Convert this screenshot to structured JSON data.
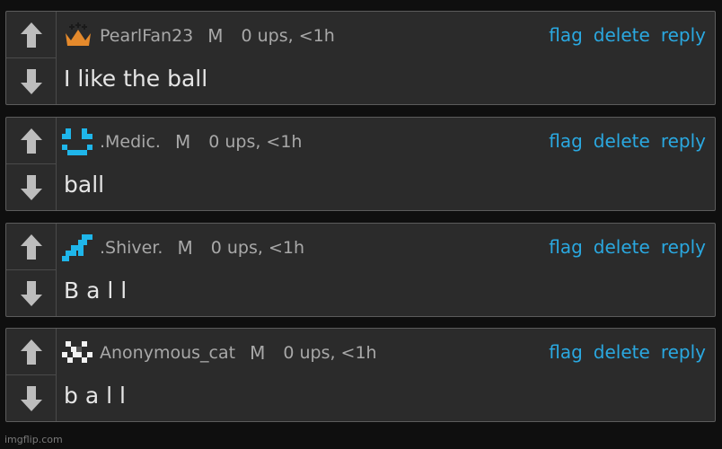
{
  "comments": [
    {
      "username": "PearlFan23",
      "mod_badge": "M",
      "meta": "0 ups, <1h",
      "text": "I like the ball",
      "avatar_icon": "crown-icon",
      "actions": {
        "flag": "flag",
        "delete": "delete",
        "reply": "reply"
      }
    },
    {
      "username": ".Medic.",
      "mod_badge": "M",
      "meta": "0 ups, <1h",
      "text": "ball",
      "avatar_icon": "pixel-face-icon",
      "actions": {
        "flag": "flag",
        "delete": "delete",
        "reply": "reply"
      }
    },
    {
      "username": ".Shiver.",
      "mod_badge": "M",
      "meta": "0 ups, <1h",
      "text": "B a l l",
      "avatar_icon": "pixel-snake-icon",
      "actions": {
        "flag": "flag",
        "delete": "delete",
        "reply": "reply"
      }
    },
    {
      "username": "Anonymous_cat",
      "mod_badge": "M",
      "meta": "0 ups, <1h",
      "text": "b a l l",
      "avatar_icon": "pixel-cat-icon",
      "actions": {
        "flag": "flag",
        "delete": "delete",
        "reply": "reply"
      }
    }
  ],
  "watermark": "imgflip.com",
  "colors": {
    "background": "#0f0f0f",
    "panel": "#2b2b2b",
    "link": "#2aa8e0",
    "crown": "#e58a2c",
    "pixel_blue": "#1fb6ea"
  }
}
